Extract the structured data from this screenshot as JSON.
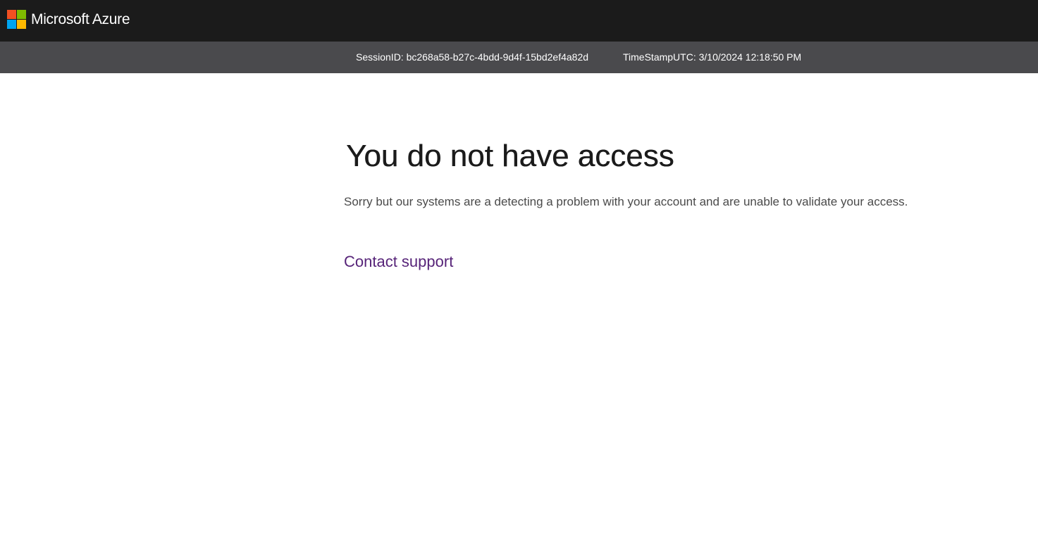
{
  "header": {
    "brand_name": "Microsoft Azure",
    "logo_icon": "microsoft-logo",
    "logo_colors": [
      "#f25022",
      "#7fba00",
      "#00a4ef",
      "#ffb900"
    ],
    "background_color": "#1b1b1b"
  },
  "infobar": {
    "session_text": "SessionID: bc268a58-b27c-4bdd-9d4f-15bd2ef4a82d",
    "timestamp_text": "TimeStampUTC: 3/10/2024 12:18:50 PM",
    "background_color": "#4a4a4d"
  },
  "main": {
    "title": "You do not have access",
    "message": "Sorry but our systems are a detecting a problem with your account and are unable to validate your access.",
    "support_link_label": "Contact support",
    "link_color": "#572479"
  }
}
